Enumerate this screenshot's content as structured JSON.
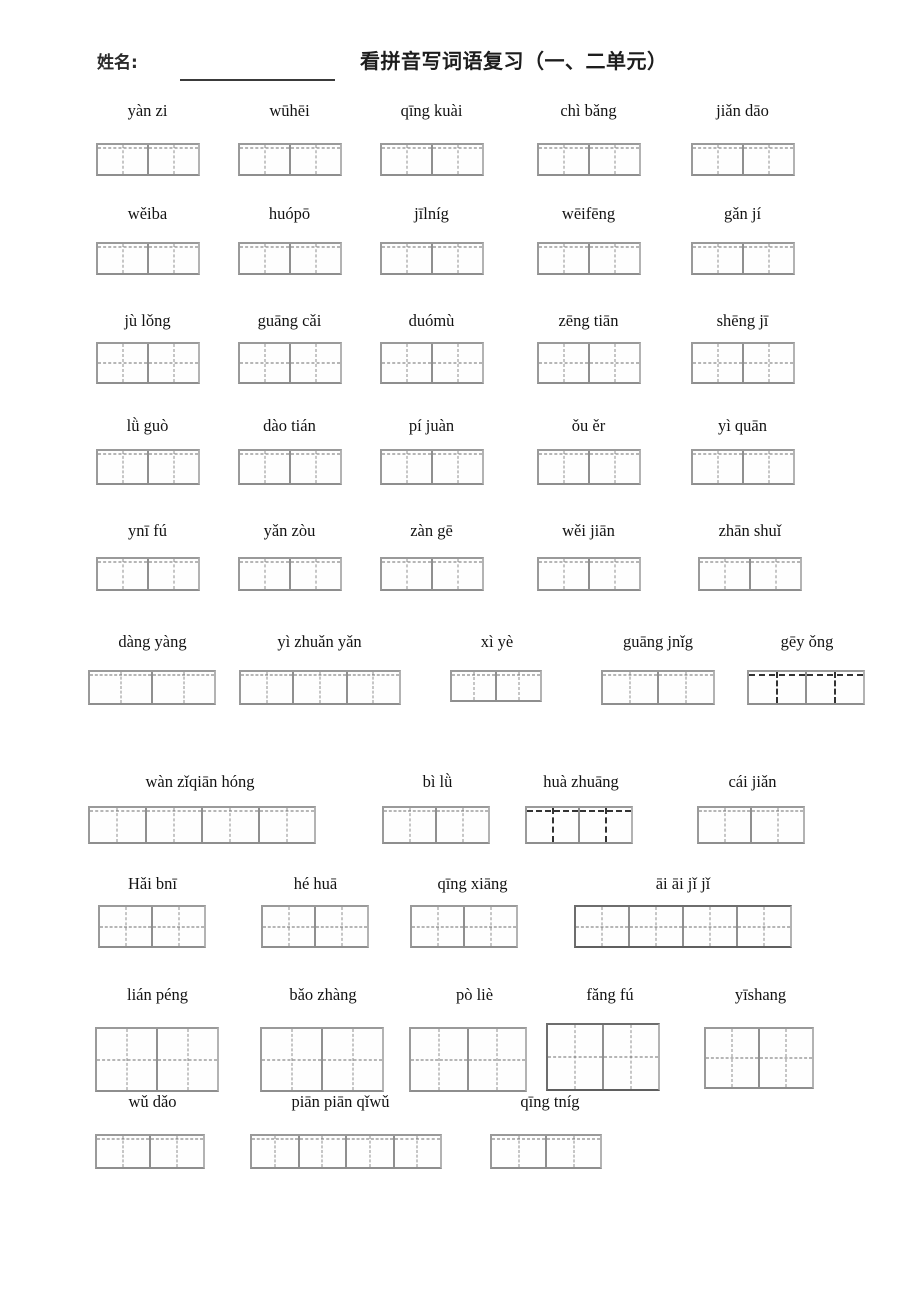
{
  "header": {
    "name_label": "姓名:",
    "title": "看拼音写词语复习（一、二单元）"
  },
  "rows": [
    {
      "row_id": "row-1",
      "items": [
        {
          "pinyin": "yàn zi",
          "cells": 2
        },
        {
          "pinyin": "wūhēi",
          "cells": 2
        },
        {
          "pinyin": "qīng kuài",
          "cells": 2
        },
        {
          "pinyin": "chì bǎng",
          "cells": 2
        },
        {
          "pinyin": "jiǎn dāo",
          "cells": 2
        }
      ]
    },
    {
      "row_id": "row-2",
      "items": [
        {
          "pinyin": "wěiba",
          "cells": 2
        },
        {
          "pinyin": "huópō",
          "cells": 2
        },
        {
          "pinyin": "jīlníg",
          "cells": 2
        },
        {
          "pinyin": "wēifēng",
          "cells": 2
        },
        {
          "pinyin": "gǎn jí",
          "cells": 2
        }
      ]
    },
    {
      "row_id": "row-3",
      "items": [
        {
          "pinyin": "jù lǒng",
          "cells": 2
        },
        {
          "pinyin": "guāng cǎi",
          "cells": 2
        },
        {
          "pinyin": "duómù",
          "cells": 2
        },
        {
          "pinyin": "zēng tiān",
          "cells": 2
        },
        {
          "pinyin": "shēng jī",
          "cells": 2
        }
      ]
    },
    {
      "row_id": "row-4",
      "items": [
        {
          "pinyin": "lǜ guò",
          "cells": 2
        },
        {
          "pinyin": "dào tián",
          "cells": 2
        },
        {
          "pinyin": "pí juàn",
          "cells": 2
        },
        {
          "pinyin": "ǒu  ěr",
          "cells": 2
        },
        {
          "pinyin": "yì quān",
          "cells": 2
        }
      ]
    },
    {
      "row_id": "row-5",
      "items": [
        {
          "pinyin": "ynī fú",
          "cells": 2
        },
        {
          "pinyin": "yǎn zòu",
          "cells": 2
        },
        {
          "pinyin": "zàn  gē",
          "cells": 2
        },
        {
          "pinyin": "wěi jiān",
          "cells": 2
        },
        {
          "pinyin": "zhān shuǐ",
          "cells": 2
        }
      ]
    },
    {
      "row_id": "row-6",
      "items": [
        {
          "pinyin": "dàng yàng",
          "cells": 2
        },
        {
          "pinyin": "yì zhuǎn yǎn",
          "cells": 3
        },
        {
          "pinyin": "xì yè",
          "cells": 2
        },
        {
          "pinyin": "guāng jnǐg",
          "cells": 2
        },
        {
          "pinyin": "gēy ǒng",
          "cells": 2
        }
      ]
    },
    {
      "row_id": "row-7",
      "items": [
        {
          "pinyin": "wàn  zǐqiān  hóng",
          "cells": 4
        },
        {
          "pinyin": "bì lǜ",
          "cells": 2
        },
        {
          "pinyin": "huà zhuāng",
          "cells": 2
        },
        {
          "pinyin": "cái  jiǎn",
          "cells": 2
        }
      ]
    },
    {
      "row_id": "row-8",
      "items": [
        {
          "pinyin": "Hǎi  bnī",
          "cells": 2
        },
        {
          "pinyin": "hé huā",
          "cells": 2
        },
        {
          "pinyin": "qīng xiāng",
          "cells": 2
        },
        {
          "pinyin": "āi    āi   jǐ  jǐ",
          "cells": 4
        }
      ]
    },
    {
      "row_id": "row-9",
      "items": [
        {
          "pinyin": "lián péng",
          "cells": 2
        },
        {
          "pinyin": "bǎo zhàng",
          "cells": 2
        },
        {
          "pinyin": "pò liè",
          "cells": 2
        },
        {
          "pinyin": "fǎng fú",
          "cells": 2
        },
        {
          "pinyin": "yīshang",
          "cells": 2
        }
      ]
    },
    {
      "row_id": "row-10",
      "items": [
        {
          "pinyin": "wǔ dǎo",
          "cells": 2
        },
        {
          "pinyin": "piān piān qǐwǔ",
          "cells": 4
        },
        {
          "pinyin": "qīng tníg",
          "cells": 2
        }
      ]
    }
  ]
}
